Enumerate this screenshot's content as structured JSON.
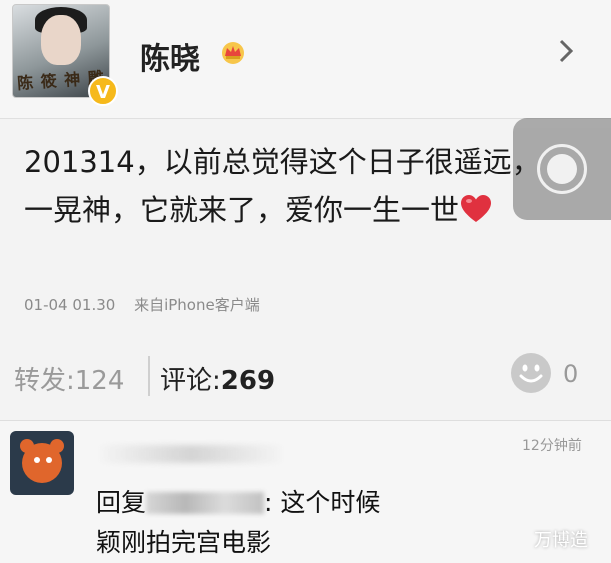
{
  "header": {
    "username": "陈晓",
    "vip_badge": "V",
    "icons": {
      "crown": "crown-icon",
      "chevron": "chevron-right-icon",
      "verified": "verified-v-badge"
    },
    "avatar_caption": "陈 筱 神 雕"
  },
  "post": {
    "text": "201314，以前总觉得这个日子很遥远，一晃神，它就来了，爱你一生一世",
    "time": "01-04 01.30",
    "source": "来自iPhone客户端"
  },
  "stats": {
    "repost_label": "转发:",
    "repost_count": "124",
    "comment_label": "评论:",
    "comment_count": "269",
    "like_count": "0"
  },
  "reply": {
    "time": "12分钟前",
    "prefix": "回复",
    "after_blur": ": 这个时候",
    "line2": "颖刚拍完宫电影"
  },
  "watermark": "万博造",
  "colors": {
    "background": "#f3f3f3",
    "heart": "#e0313f",
    "badge_gold": "#f6b91b",
    "muted_text": "#9a9a9a"
  }
}
